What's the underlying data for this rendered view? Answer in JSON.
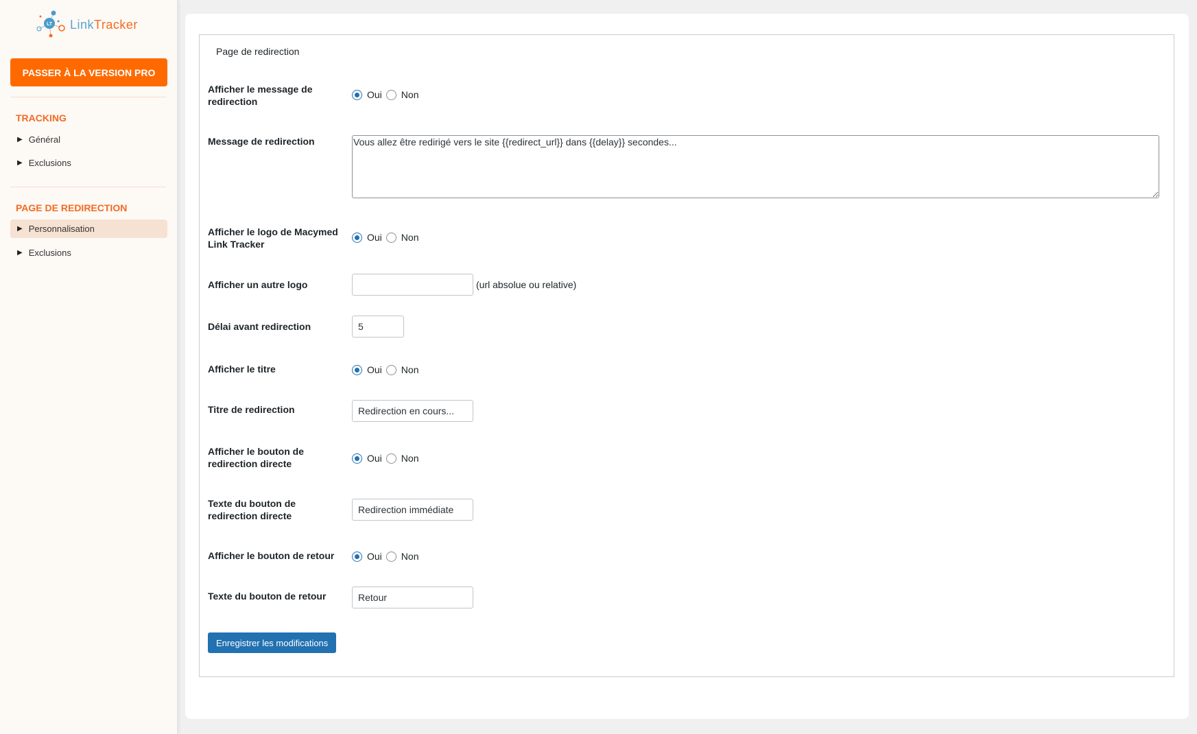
{
  "sidebar": {
    "logo": {
      "part1": "Link",
      "part2": "Tracker"
    },
    "pro_button": "PASSER À LA VERSION PRO",
    "sections": [
      {
        "title": "TRACKING",
        "items": [
          {
            "label": "Général"
          },
          {
            "label": "Exclusions"
          }
        ]
      },
      {
        "title": "PAGE DE REDIRECTION",
        "items": [
          {
            "label": "Personnalisation",
            "active": true
          },
          {
            "label": "Exclusions"
          }
        ]
      }
    ]
  },
  "form": {
    "legend": "Page de redirection",
    "radio_yes": "Oui",
    "radio_no": "Non",
    "show_message": {
      "label": "Afficher le message de redirection",
      "value": "Oui"
    },
    "message": {
      "label": "Message de redirection",
      "value": "Vous allez être redirigé vers le site {{redirect_url}} dans {{delay}} secondes..."
    },
    "show_logo": {
      "label": "Afficher le logo de Macymed Link Tracker",
      "value": "Oui"
    },
    "other_logo": {
      "label": "Afficher un autre logo",
      "value": "",
      "hint": "(url absolue ou relative)"
    },
    "delay": {
      "label": "Délai avant redirection",
      "value": "5"
    },
    "show_title": {
      "label": "Afficher le titre",
      "value": "Oui"
    },
    "title": {
      "label": "Titre de redirection",
      "value": "Redirection en cours..."
    },
    "show_direct": {
      "label": "Afficher le bouton de redirection directe",
      "value": "Oui"
    },
    "direct_text": {
      "label": "Texte du bouton de redirection directe",
      "value": "Redirection immédiate"
    },
    "show_back": {
      "label": "Afficher le bouton de retour",
      "value": "Oui"
    },
    "back_text": {
      "label": "Texte du bouton de retour",
      "value": "Retour"
    },
    "save_label": "Enregistrer les modifications"
  }
}
